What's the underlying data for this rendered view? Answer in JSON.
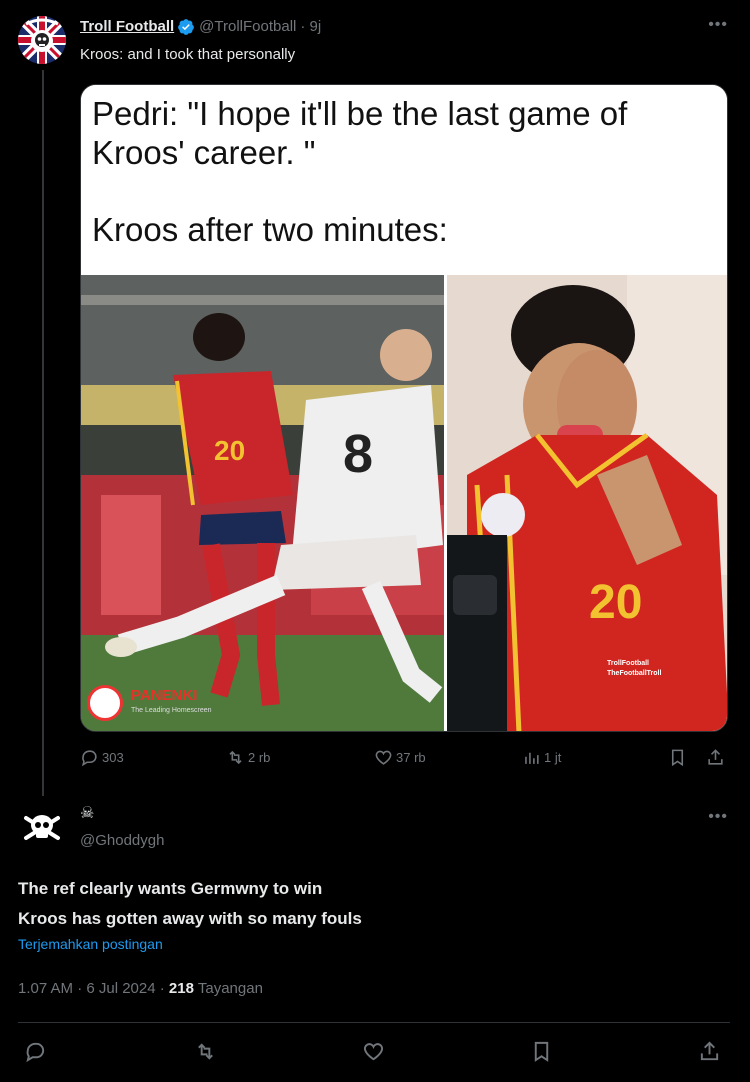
{
  "parent_tweet": {
    "display_name": "Troll Football",
    "handle": "@TrollFootball",
    "time": "· 9j",
    "text": "Kroos: and I took that personally",
    "meme": {
      "line1": "Pedri: \"I hope it'll be the last game of",
      "line2": "Kroos' career. \"",
      "line3": "Kroos after two minutes:",
      "left_watermark": "PANENKI",
      "left_watermark_sub": "The Leading Homescreen",
      "right_watermark_1": "TrollFootball",
      "right_watermark_2": "TheFootballTroll",
      "left_jersey_number": "20",
      "white_jersey_number": "8",
      "right_jersey_number": "20"
    },
    "actions": {
      "replies": "303",
      "reposts": "2 rb",
      "likes": "37 rb",
      "views": "1 jt"
    }
  },
  "reply_tweet": {
    "display_name": "☠",
    "handle": "@Ghoddygh",
    "text_line1": "The ref clearly wants Germwny to win",
    "text_line2": "Kroos has gotten away with so many fouls",
    "translate_label": "Terjemahkan postingan",
    "timestamp": "1.07 AM · 6 Jul 2024 ·",
    "view_count": "218",
    "view_label": "Tayangan"
  },
  "icons": {
    "verified_color": "#1d9bf0",
    "link_color": "#1d9bf0",
    "muted_color": "#71767b"
  }
}
